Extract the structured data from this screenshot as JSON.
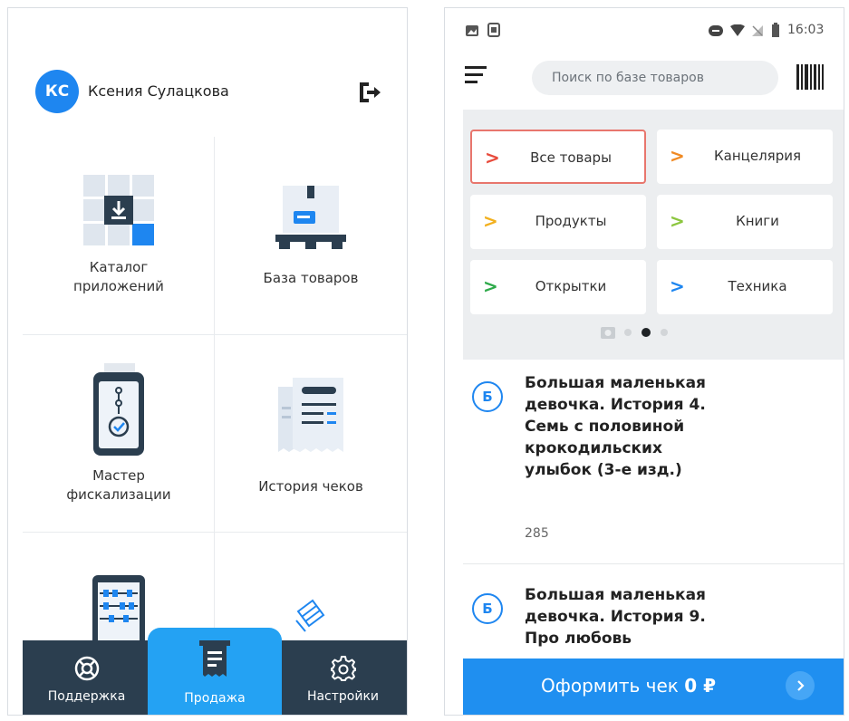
{
  "left": {
    "user": {
      "initials": "КС",
      "name": "Ксения Сулацкова"
    },
    "tiles": [
      {
        "label": "Каталог\nприложений",
        "icon": "app-catalog-icon"
      },
      {
        "label": "База товаров",
        "icon": "product-box-icon"
      },
      {
        "label": "Мастер\nфискализации",
        "icon": "fiscal-terminal-icon"
      },
      {
        "label": "История чеков",
        "icon": "receipts-icon"
      },
      {
        "label": "",
        "icon": "abacus-icon"
      },
      {
        "label": "",
        "icon": "tickets-icon"
      }
    ],
    "nav": {
      "support": "Поддержка",
      "sale": "Продажа",
      "settings": "Настройки"
    }
  },
  "right": {
    "status": {
      "time": "16:03"
    },
    "search": {
      "placeholder": "Поиск по базе товаров"
    },
    "categories": [
      {
        "label": "Все товары",
        "color": "#e84b3c",
        "selected": true
      },
      {
        "label": "Канцелярия",
        "color": "#f08a24",
        "selected": false
      },
      {
        "label": "Продукты",
        "color": "#f2b01e",
        "selected": false
      },
      {
        "label": "Книги",
        "color": "#8cc63f",
        "selected": false
      },
      {
        "label": "Открытки",
        "color": "#2eaa4a",
        "selected": false
      },
      {
        "label": "Техника",
        "color": "#1e86f0",
        "selected": false
      }
    ],
    "products": [
      {
        "badge": "Б",
        "title": "Большая маленькая девочка. История 4. Семь с половиной крокодильских улыбок (3-е изд.)",
        "price": "285"
      },
      {
        "badge": "Б",
        "title": "Большая маленькая девочка. История 9. Про любовь",
        "price": ""
      }
    ],
    "checkout": {
      "label": "Оформить чек",
      "amount": "0 ₽"
    }
  }
}
